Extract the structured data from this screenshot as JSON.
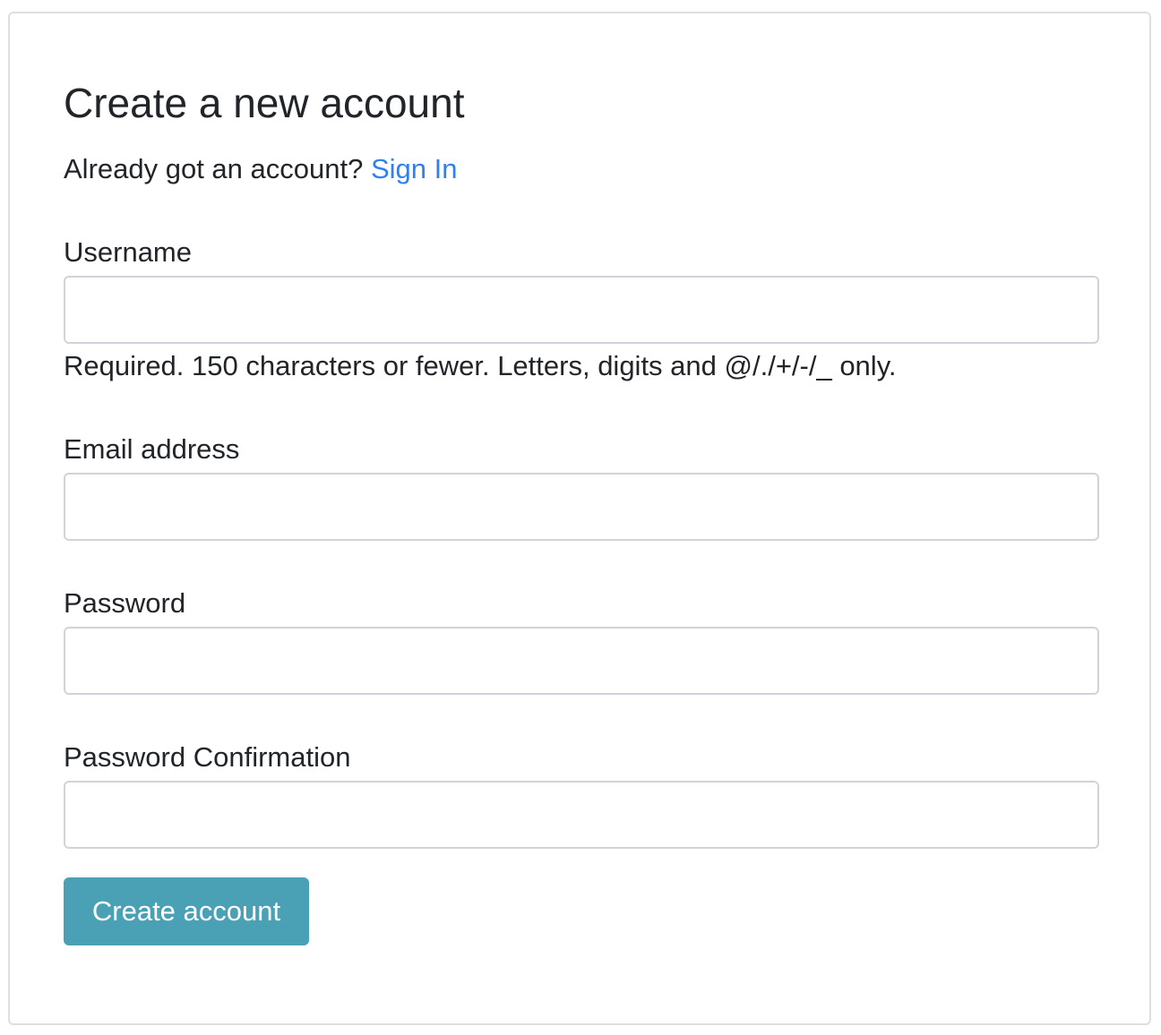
{
  "form": {
    "title": "Create a new account",
    "signin_prompt": "Already got an account?",
    "signin_link": "Sign In",
    "username": {
      "label": "Username",
      "value": "",
      "help": "Required. 150 characters or fewer. Letters, digits and @/./+/-/_ only."
    },
    "email": {
      "label": "Email address",
      "value": ""
    },
    "password": {
      "label": "Password",
      "value": ""
    },
    "password_confirmation": {
      "label": "Password Confirmation",
      "value": ""
    },
    "submit_label": "Create account"
  },
  "colors": {
    "link": "#2f7ff5",
    "button": "#4aa0b5",
    "border": "#ced4da",
    "text": "#212529"
  }
}
